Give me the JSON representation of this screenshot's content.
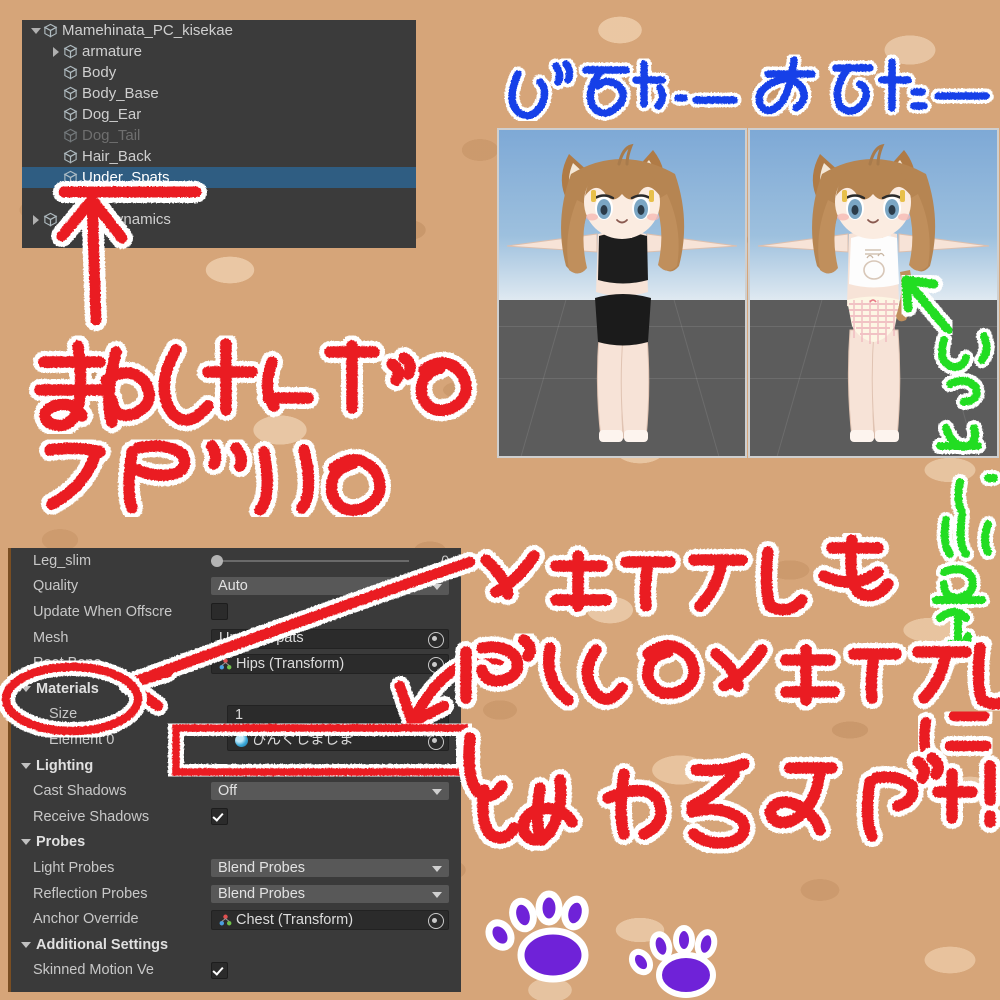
{
  "background": {
    "style": "cork-board-texture",
    "base_color": "#d6a579"
  },
  "hierarchy": {
    "name": "unity-hierarchy-panel",
    "selection_color": "#2f5d82",
    "rows": [
      {
        "label": "Mamehinata_PC_kisekae",
        "indent": 0,
        "toggle": "down",
        "state": "normal",
        "selected": false
      },
      {
        "label": "armature",
        "indent": 1,
        "toggle": "right",
        "state": "normal",
        "selected": false
      },
      {
        "label": "Body",
        "indent": 1,
        "toggle": "none",
        "state": "normal",
        "selected": false
      },
      {
        "label": "Body_Base",
        "indent": 1,
        "toggle": "none",
        "state": "normal",
        "selected": false
      },
      {
        "label": "Dog_Ear",
        "indent": 1,
        "toggle": "none",
        "state": "normal",
        "selected": false
      },
      {
        "label": "Dog_Tail",
        "indent": 1,
        "toggle": "none",
        "state": "disabled",
        "selected": false
      },
      {
        "label": "Hair_Back",
        "indent": 1,
        "toggle": "none",
        "state": "normal",
        "selected": false
      },
      {
        "label": "Under_Spats",
        "indent": 1,
        "toggle": "none",
        "state": "normal",
        "selected": true
      },
      {
        "label": "",
        "indent": 1,
        "toggle": "none",
        "state": "normal",
        "selected": false
      },
      {
        "label": "AvatarDynamics",
        "indent": 0,
        "toggle": "right",
        "state": "normal",
        "selected": false
      }
    ]
  },
  "inspector": {
    "name": "unity-inspector-panel",
    "rows": [
      {
        "kind": "slider",
        "label": "Leg_slim",
        "value": "0"
      },
      {
        "kind": "dropdown",
        "label": "Quality",
        "value": "Auto"
      },
      {
        "kind": "checkbox",
        "label": "Update When Offscre",
        "checked": false
      },
      {
        "kind": "object",
        "label": "Mesh",
        "value": "Under_Spats",
        "icon": "mesh-icon"
      },
      {
        "kind": "object",
        "label": "Root Bone",
        "value": "Hips (Transform)",
        "icon": "transform-axis-icon"
      },
      {
        "kind": "header",
        "label": "Materials"
      },
      {
        "kind": "sizefield",
        "label": "Size",
        "value": "1"
      },
      {
        "kind": "object",
        "label": "Element 0",
        "value": "ぴんくしましま",
        "icon": "material-sphere-icon"
      },
      {
        "kind": "header",
        "label": "Lighting"
      },
      {
        "kind": "dropdown",
        "label": "Cast Shadows",
        "value": "Off"
      },
      {
        "kind": "checkbox",
        "label": "Receive Shadows",
        "checked": true
      },
      {
        "kind": "header",
        "label": "Probes"
      },
      {
        "kind": "dropdown",
        "label": "Light Probes",
        "value": "Blend Probes"
      },
      {
        "kind": "dropdown",
        "label": "Reflection Probes",
        "value": "Blend Probes"
      },
      {
        "kind": "object",
        "label": "Anchor Override",
        "value": "Chest (Transform)",
        "icon": "transform-axis-icon"
      },
      {
        "kind": "header",
        "label": "Additional Settings"
      },
      {
        "kind": "checkbox",
        "label": "Skinned Motion Ve",
        "checked": true
      }
    ]
  },
  "screenshots": [
    {
      "name": "before-avatar-screenshot",
      "caption": "びふはー",
      "caption_color": "#1540e8",
      "outfit": "black tank top and black spats",
      "pose": "T-pose"
    },
    {
      "name": "after-avatar-screenshot",
      "caption": "あふたー",
      "caption_color": "#1540e8",
      "outfit": "white camisole and pink striped panties",
      "pose": "T-pose"
    }
  ],
  "annotations": {
    "red_color": "#ea1d23",
    "green_color": "#22dd22",
    "blue_color": "#1540e8",
    "purple_color": "#6f22d8",
    "texts": [
      {
        "id": "title-line-1",
        "text": "まめひなたの",
        "color": "#ea1d23"
      },
      {
        "id": "title-line-2",
        "text": "スパッツの",
        "color": "#ea1d23"
      },
      {
        "id": "instruction-line-1",
        "text": "マテリアルを",
        "color": "#ea1d23"
      },
      {
        "id": "instruction-line-2",
        "text": "ぱんつのマテリアル",
        "color": "#ea1d23"
      },
      {
        "id": "instruction-line-2-suffix",
        "text": "に",
        "color": "#ea1d23"
      },
      {
        "id": "instruction-line-3",
        "text": "いれかえるだけ!!",
        "color": "#ea1d23"
      },
      {
        "id": "green-note",
        "text": "しゅつもいいれかえ↑",
        "color": "#22dd22"
      }
    ],
    "marks": [
      {
        "id": "arrow-to-under-spats",
        "color": "#ea1d23",
        "points_at": "Under_Spats hierarchy row"
      },
      {
        "id": "arrow-to-materials",
        "color": "#ea1d23",
        "points_at": "Materials section"
      },
      {
        "id": "ellipse-around-materials",
        "color": "#ea1d23",
        "encircles": "Materials"
      },
      {
        "id": "arrow-to-element-0",
        "color": "#ea1d23",
        "points_at": "Element 0 material field"
      },
      {
        "id": "box-around-element-0",
        "color": "#ea1d23",
        "encircles": "ぴんくしましま"
      },
      {
        "id": "green-arrow-to-panties",
        "color": "#22dd22",
        "points_at": "after avatar underwear"
      }
    ],
    "paw_prints": [
      {
        "id": "paw-print-large",
        "color": "#6f22d8"
      },
      {
        "id": "paw-print-small",
        "color": "#6f22d8"
      }
    ]
  }
}
